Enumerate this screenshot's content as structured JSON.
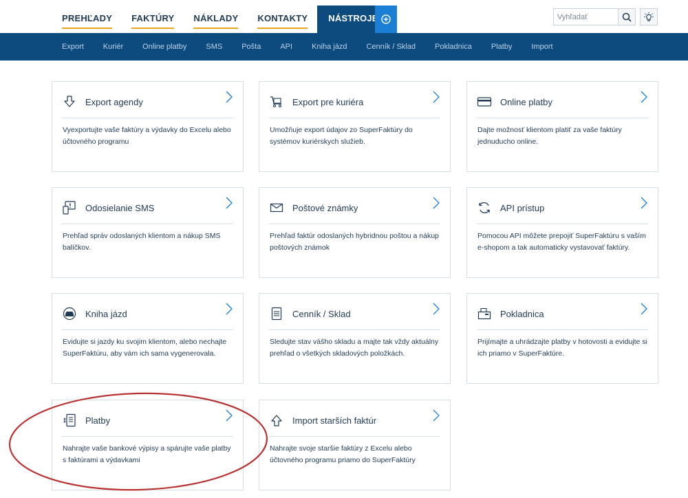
{
  "main_nav": [
    {
      "label": "PREHĽADY",
      "active": false
    },
    {
      "label": "FAKTÚRY",
      "active": false
    },
    {
      "label": "NÁKLADY",
      "active": false
    },
    {
      "label": "KONTAKTY",
      "active": false
    },
    {
      "label": "NÁSTROJE",
      "active": true
    }
  ],
  "add_button_icon": "plus-circle-icon",
  "search": {
    "placeholder": "Vyhľadať",
    "button_icon": "search-icon"
  },
  "help_icon": "lightbulb-icon",
  "sub_nav": [
    "Export",
    "Kuriér",
    "Online platby",
    "SMS",
    "Pošta",
    "API",
    "Kniha jázd",
    "Cenník / Sklad",
    "Pokladnica",
    "Platby",
    "Import"
  ],
  "cards": [
    {
      "icon": "download-arrow-icon",
      "title": "Export agendy",
      "desc": "Vyexportujte vaše faktúry a výdavky do Excelu alebo účtovného programu"
    },
    {
      "icon": "cart-icon",
      "title": "Export pre kuriéra",
      "desc": "Umožňuje export údajov zo SuperFaktúry do systémov kuriérskych služieb."
    },
    {
      "icon": "credit-card-icon",
      "title": "Online platby",
      "desc": "Dajte možnosť klientom platiť za vaše faktúry jednuducho online."
    },
    {
      "icon": "phone-alert-icon",
      "title": "Odosielanie SMS",
      "desc": "Prehľad správ odoslaných klientom a nákup SMS balíčkov."
    },
    {
      "icon": "envelope-icon",
      "title": "Poštové známky",
      "desc": "Prehľad faktúr odoslaných hybridnou poštou a nákup poštových známok"
    },
    {
      "icon": "sync-arrows-icon",
      "title": "API prístup",
      "desc": "Pomocou API môžete prepojiť SuperFaktúru s vaším e-shopom a tak automaticky vystavovať faktúry."
    },
    {
      "icon": "car-icon",
      "title": "Kniha jázd",
      "desc": "Evidujte si jazdy ku svojim klientom, alebo nechajte SuperFaktúru, aby vám ich sama vygenerovala."
    },
    {
      "icon": "list-document-icon",
      "title": "Cenník / Sklad",
      "desc": "Sledujte stav vášho skladu a majte tak vždy aktuálny prehľad o všetkých skladových položkách."
    },
    {
      "icon": "cash-register-icon",
      "title": "Pokladnica",
      "desc": "Prijímajte a uhrádzajte platby v hotovosti a evidujte si ich priamo v SuperFaktúre."
    },
    {
      "icon": "bank-statement-icon",
      "title": "Platby",
      "desc": "Nahrajte vaše bankové výpisy a spárujte vaše platby s faktúrami a výdavkami"
    },
    {
      "icon": "upload-arrow-icon",
      "title": "Import starších faktúr",
      "desc": "Nahrajte svoje staršie faktúry z Excelu alebo účtovného programu priamo do SuperFaktúry"
    }
  ],
  "colors": {
    "nav_dark": "#0d4a7e",
    "add_blue": "#1c7fd6",
    "underline_orange": "#e8a317",
    "text_dark": "#1f3a55",
    "highlight_red": "#b83232"
  }
}
